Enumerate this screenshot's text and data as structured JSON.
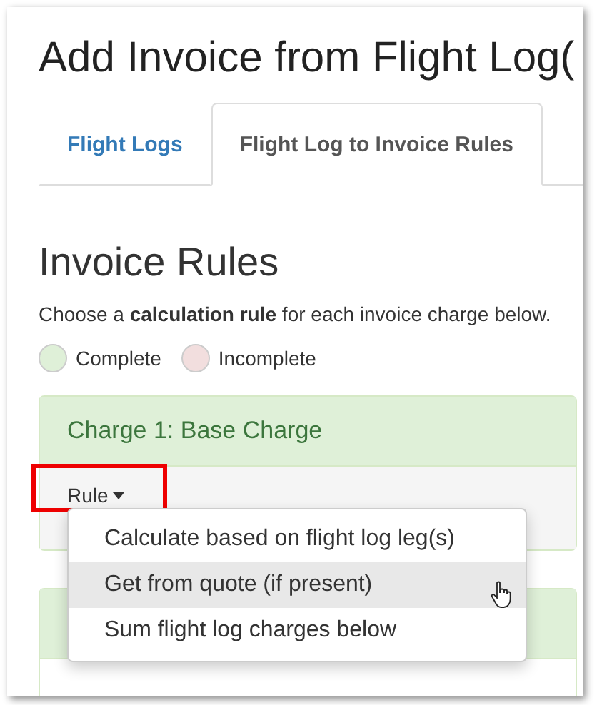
{
  "page": {
    "title": "Add Invoice from Flight Log("
  },
  "tabs": [
    {
      "label": "Flight Logs",
      "selected": false
    },
    {
      "label": "Flight Log to Invoice Rules",
      "selected": true
    }
  ],
  "section": {
    "heading": "Invoice Rules",
    "instructions": "Choose a **calculation** **rule** for each invoice charge below."
  },
  "legend": [
    {
      "label": "Complete",
      "color": "#dff0d8"
    },
    {
      "label": "Incomplete",
      "color": "#f2dede"
    }
  ],
  "charges": [
    {
      "title": "Charge 1: Base Charge",
      "complete": true,
      "rule_label": "Rule",
      "highlighted": true
    }
  ],
  "rule_menu": {
    "open": true,
    "items": [
      {
        "label": "Calculate based on flight log leg(s)",
        "selected": false
      },
      {
        "label": "Get from quote (if present)",
        "selected": true
      },
      {
        "label": "Sum flight log charges below",
        "selected": false
      }
    ]
  }
}
